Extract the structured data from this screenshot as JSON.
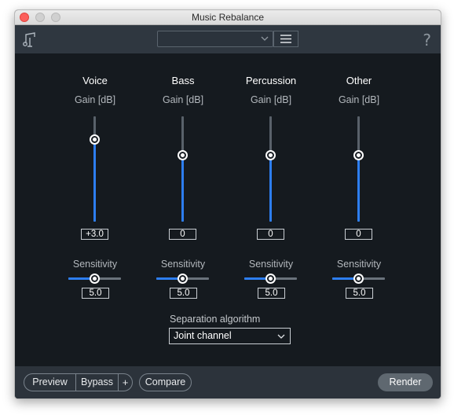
{
  "window": {
    "title": "Music Rebalance"
  },
  "topbar": {
    "preset_value": "",
    "help_glyph": "?"
  },
  "channels": [
    {
      "name": "Voice",
      "gain_label": "Gain [dB]",
      "gain_value": "+3.0",
      "gain_level": 0.78,
      "sensitivity_label": "Sensitivity",
      "sensitivity_value": "5.0",
      "sensitivity_level": 0.5
    },
    {
      "name": "Bass",
      "gain_label": "Gain [dB]",
      "gain_value": "0",
      "gain_level": 0.63,
      "sensitivity_label": "Sensitivity",
      "sensitivity_value": "5.0",
      "sensitivity_level": 0.5
    },
    {
      "name": "Percussion",
      "gain_label": "Gain [dB]",
      "gain_value": "0",
      "gain_level": 0.63,
      "sensitivity_label": "Sensitivity",
      "sensitivity_value": "5.0",
      "sensitivity_level": 0.5
    },
    {
      "name": "Other",
      "gain_label": "Gain [dB]",
      "gain_value": "0",
      "gain_level": 0.63,
      "sensitivity_label": "Sensitivity",
      "sensitivity_value": "5.0",
      "sensitivity_level": 0.5
    }
  ],
  "separation": {
    "label": "Separation algorithm",
    "value": "Joint channel"
  },
  "bottombar": {
    "preview_label": "Preview",
    "bypass_label": "Bypass",
    "plus_label": "+",
    "compare_label": "Compare",
    "render_label": "Render"
  },
  "colors": {
    "accent": "#2d7ef0",
    "background": "#151a1f",
    "toolbar": "#2f3740"
  }
}
